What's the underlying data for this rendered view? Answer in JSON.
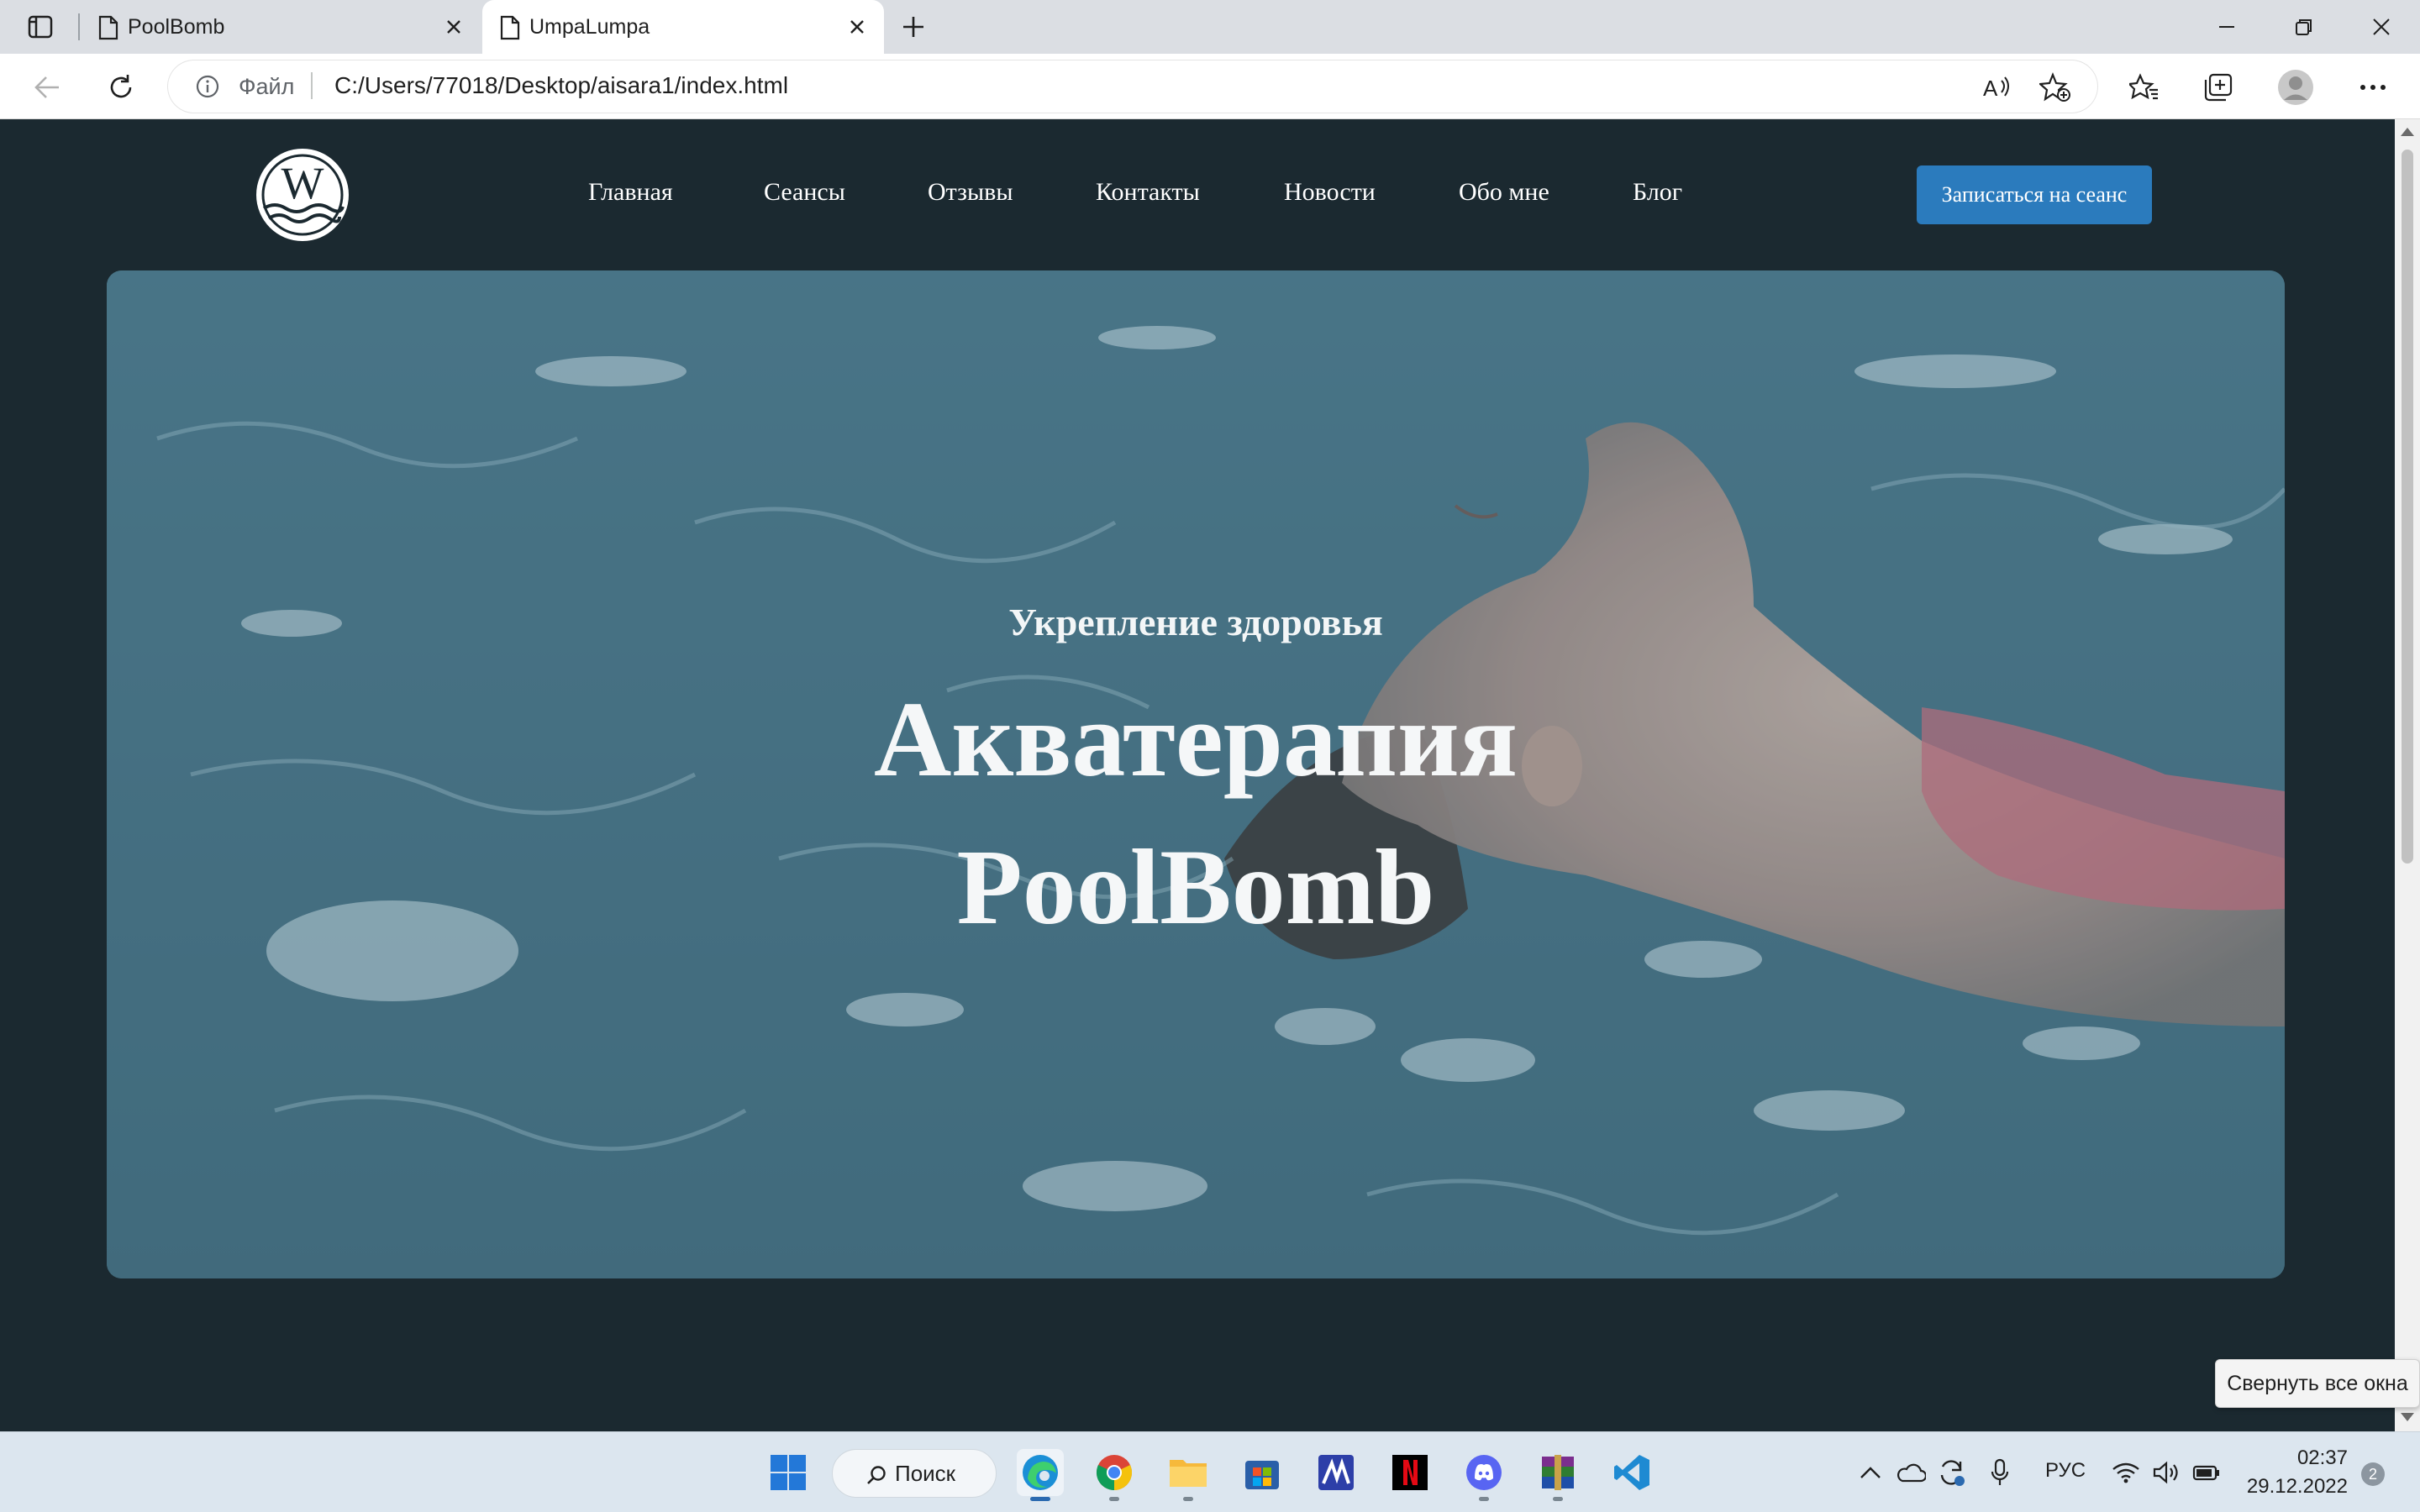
{
  "browser": {
    "tabs": [
      {
        "title": "PoolBomb",
        "active": false
      },
      {
        "title": "UmpaLumpa",
        "active": true
      }
    ],
    "address_bar": {
      "security_label": "Файл",
      "url": "C:/Users/77018/Desktop/aisara1/index.html"
    },
    "icons": [
      "tab-actions-icon",
      "page-icon",
      "close-icon",
      "new-tab-icon",
      "minimize-icon",
      "restore-icon",
      "window-close-icon",
      "back-icon",
      "refresh-icon",
      "info-icon",
      "read-aloud-icon",
      "add-favorite-icon",
      "favorites-icon",
      "collections-icon",
      "profile-icon",
      "more-icon"
    ]
  },
  "page": {
    "logo_letter": "W",
    "nav": [
      "Главная",
      "Сеансы",
      "Отзывы",
      "Контакты",
      "Новости",
      "Обо мне",
      "Блог"
    ],
    "cta_label": "Записаться на сеанс",
    "hero": {
      "subtitle": "Укрепление здоровья",
      "title_line1": "Акватерапия",
      "title_line2": "PoolBomb"
    }
  },
  "tooltip": "Свернуть все окна",
  "taskbar": {
    "search_label": "Поиск",
    "apps": [
      "windows-start-icon",
      "edge-icon",
      "chrome-icon",
      "file-explorer-icon",
      "microsoft-store-icon",
      "mathcad-icon",
      "netflix-icon",
      "discord-icon",
      "winrar-icon",
      "vscode-icon"
    ],
    "tray": {
      "language": "РУС",
      "time": "02:37",
      "date": "29.12.2022",
      "notifications": "2"
    }
  },
  "colors": {
    "page_bg": "#1b2930",
    "cta": "#2b7bbd",
    "hero_water": "#4d7c8e"
  }
}
